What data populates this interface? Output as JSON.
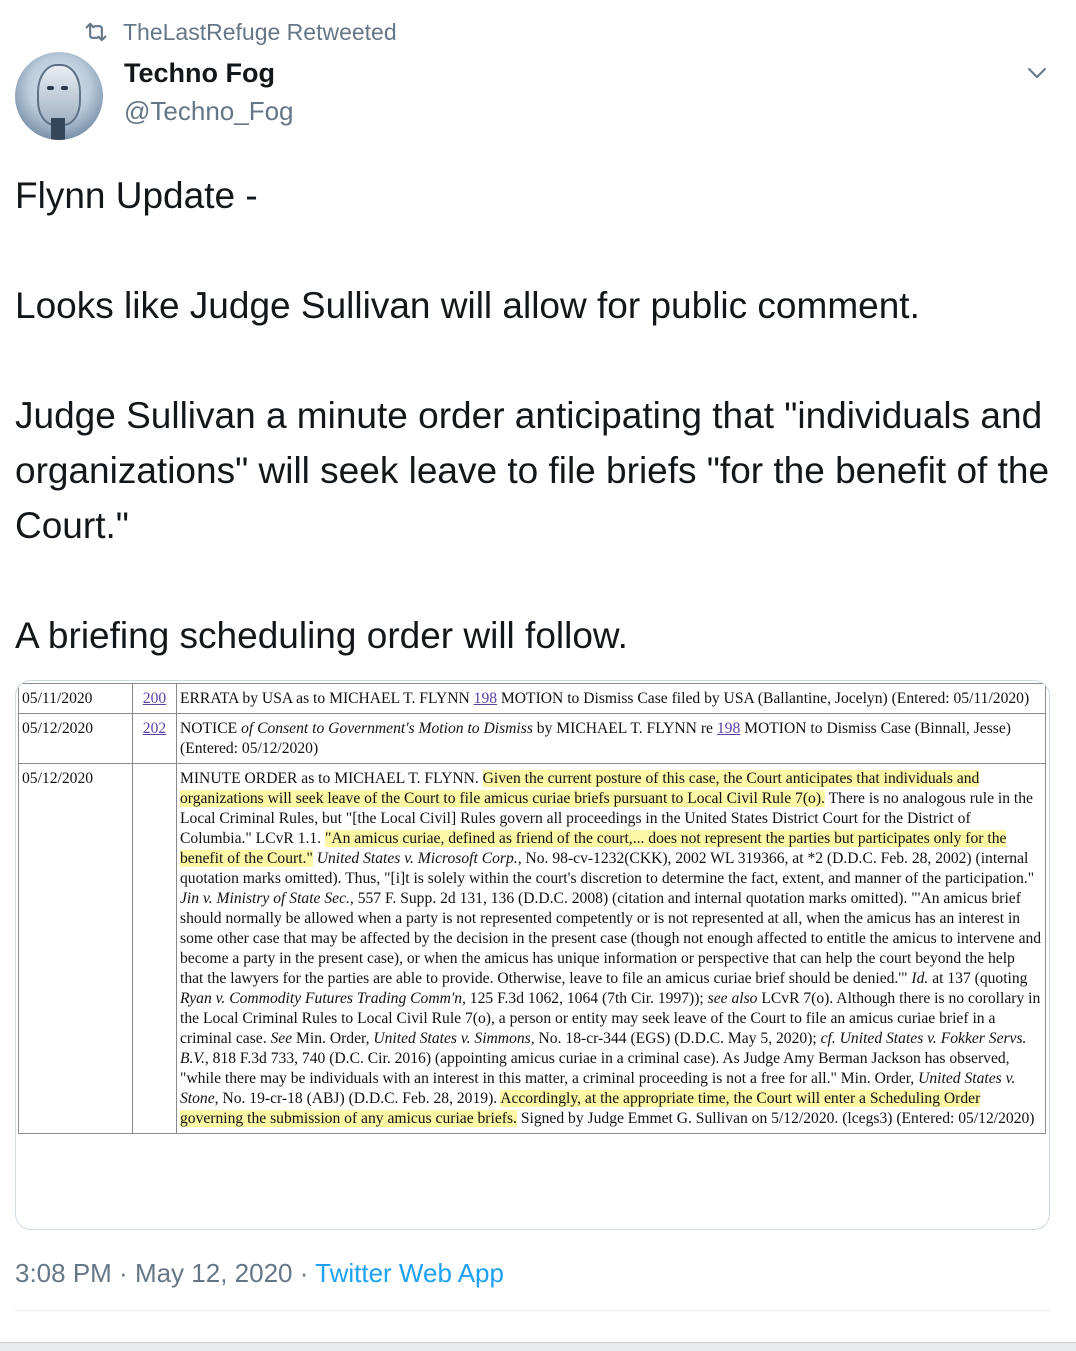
{
  "retweet": {
    "icon": "retweet-icon",
    "label": "TheLastRefuge Retweeted"
  },
  "author": {
    "avatar": "robot-avatar",
    "name": "Techno Fog",
    "handle": "@Techno_Fog"
  },
  "menu": {
    "icon": "chevron-down-icon"
  },
  "tweet": {
    "paragraphs": [
      "Flynn Update -",
      "Looks like Judge Sullivan will allow for public comment.",
      "Judge Sullivan a minute order anticipating that \"individuals and organizations\" will seek leave to file briefs \"for the benefit of the Court.\"",
      "A briefing scheduling order will follow."
    ]
  },
  "docket": {
    "rows": [
      {
        "date": "05/11/2020",
        "num": "200",
        "parts": [
          {
            "t": "ERRATA by USA as to MICHAEL T. FLYNN "
          },
          {
            "link": "198"
          },
          {
            "t": " MOTION to Dismiss Case filed by USA (Ballantine, Jocelyn) (Entered: 05/11/2020)"
          }
        ]
      },
      {
        "date": "05/12/2020",
        "num": "202",
        "parts": [
          {
            "t": "NOTICE "
          },
          {
            "i": "of Consent to Government's Motion to Dismiss"
          },
          {
            "t": " by MICHAEL T. FLYNN re "
          },
          {
            "link": "198"
          },
          {
            "t": " MOTION to Dismiss Case (Binnall, Jesse) (Entered: 05/12/2020)"
          }
        ]
      },
      {
        "date": "05/12/2020",
        "num": "",
        "parts": [
          {
            "t": "MINUTE ORDER as to MICHAEL T. FLYNN. "
          },
          {
            "hl": "Given the current posture of this case, the Court anticipates that individuals and organizations will seek leave of the Court to file amicus curiae briefs pursuant to Local Civil Rule 7(o)."
          },
          {
            "t": " There is no analogous rule in the Local Criminal Rules, but \"[the Local Civil] Rules govern all proceedings in the United States District Court for the District of Columbia.\" LCvR 1.1. "
          },
          {
            "hl": "\"An amicus curiae, defined as friend of the court,... does not represent the parties but participates only for the benefit of the Court.\""
          },
          {
            "t": " "
          },
          {
            "i": "United States v. Microsoft Corp."
          },
          {
            "t": ", No. 98-cv-1232(CKK), 2002 WL 319366, at *2 (D.D.C. Feb. 28, 2002) (internal quotation marks omitted). Thus, \"[i]t is solely within the court's discretion to determine the fact, extent, and manner of the participation.\" "
          },
          {
            "i": "Jin v. Ministry of State Sec."
          },
          {
            "t": ", 557 F. Supp. 2d 131, 136 (D.D.C. 2008) (citation and internal quotation marks omitted). \"'An amicus brief should normally be allowed when a party is not represented competently or is not represented at all, when the amicus has an interest in some other case that may be affected by the decision in the present case (though not enough affected to entitle the amicus to intervene and become a party in the present case), or when the amicus has unique information or perspective that can help the court beyond the help that the lawyers for the parties are able to provide. Otherwise, leave to file an amicus curiae brief should be denied.'\" "
          },
          {
            "i": "Id."
          },
          {
            "t": " at 137 (quoting "
          },
          {
            "i": "Ryan v. Commodity Futures Trading Comm'n"
          },
          {
            "t": ", 125 F.3d 1062, 1064 (7th Cir. 1997)); "
          },
          {
            "i": "see also"
          },
          {
            "t": " LCvR 7(o). Although there is no corollary in the Local Criminal Rules to Local Civil Rule 7(o), a person or entity may seek leave of the Court to file an amicus curiae brief in a criminal case. "
          },
          {
            "i": "See"
          },
          {
            "t": " Min. Order, "
          },
          {
            "i": "United States v. Simmons"
          },
          {
            "t": ", No. 18-cr-344 (EGS) (D.D.C. May 5, 2020); "
          },
          {
            "i": "cf. United States v. Fokker Servs. B.V."
          },
          {
            "t": ", 818 F.3d 733, 740 (D.C. Cir. 2016) (appointing amicus curiae in a criminal case). As Judge Amy Berman Jackson has observed, \"while there may be individuals with an interest in this matter, a criminal proceeding is not a free for all.\" Min. Order, "
          },
          {
            "i": "United States v. Stone"
          },
          {
            "t": ", No. 19-cr-18 (ABJ) (D.D.C. Feb. 28, 2019). "
          },
          {
            "hl": "Accordingly, at the appropriate time, the Court will enter a Scheduling Order governing the submission of any amicus curiae briefs."
          },
          {
            "t": " Signed by Judge Emmet G. Sullivan on 5/12/2020. (lcegs3) (Entered: 05/12/2020)"
          }
        ]
      }
    ]
  },
  "meta": {
    "time": "3:08 PM",
    "sep": " · ",
    "date": "May 12, 2020",
    "app": "Twitter Web App"
  },
  "colors": {
    "accent": "#1da1f2",
    "secondary_text": "#657786",
    "highlight": "#fbf7a5",
    "link": "#5b3fa6"
  }
}
